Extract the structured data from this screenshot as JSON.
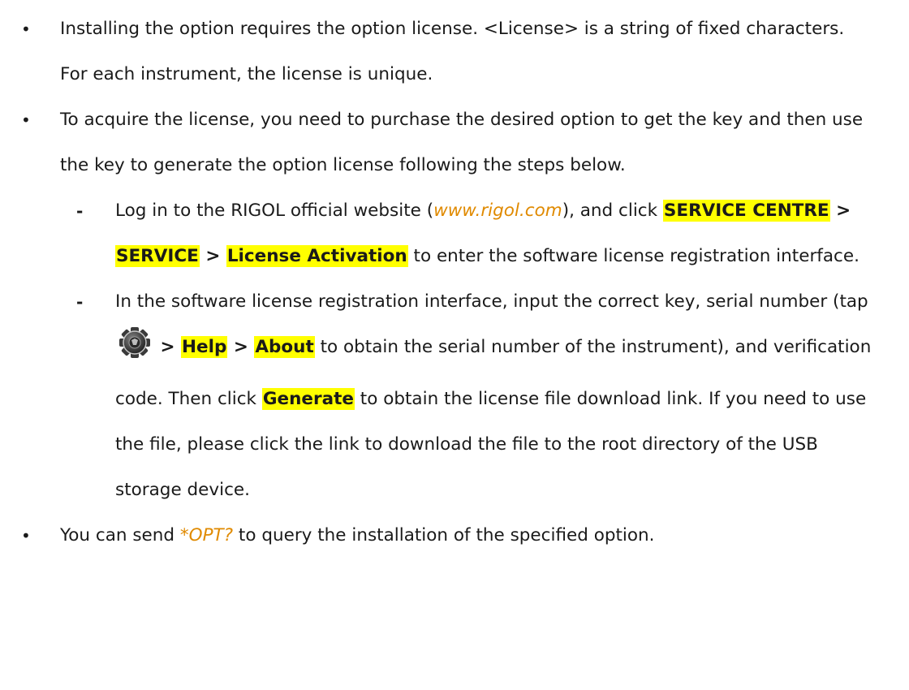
{
  "bullets": {
    "dot": "•",
    "dash": "-"
  },
  "p1": {
    "text": "Installing the option requires the option license. <License> is a string of fixed characters. For each instrument, the license is unique."
  },
  "p2": {
    "text": "To acquire the license, you need to purchase the desired option to get the key and then use the key to generate the option license following the steps below."
  },
  "sub1": {
    "pre": "Log in to the RIGOL official website (",
    "link": "www.rigol.com",
    "mid": "), and click ",
    "btn1": "SERVICE CENTRE",
    "sep1": " > ",
    "btn2": "SERVICE",
    "sep2": " > ",
    "btn3": "License Activation",
    "post": " to enter the software license registration interface."
  },
  "sub2": {
    "pre": "In the software license registration interface, input the correct key, serial number (tap",
    "sep1": " > ",
    "btn1": "Help",
    "sep2": " > ",
    "btn2": "About",
    "mid": " to obtain the serial number of the instrument), and verification code. Then click ",
    "btn3": "Generate",
    "post": " to obtain the license file download link. If you need to use the file, please click the link to download the file to the root directory of the USB storage device."
  },
  "p3": {
    "pre": "You can send ",
    "cmd": "*OPT?",
    "post": " to query the installation of the specified option."
  },
  "icons": {
    "gear": "gear-settings-icon"
  }
}
